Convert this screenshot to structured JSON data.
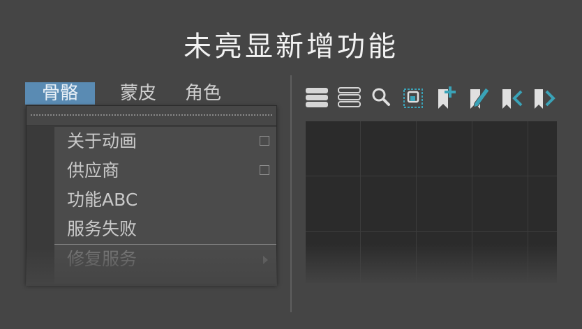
{
  "title": "未亮显新增功能",
  "tabs": [
    {
      "label": "骨骼",
      "active": true
    },
    {
      "label": "蒙皮",
      "active": false
    },
    {
      "label": "角色",
      "active": false
    }
  ],
  "menu": {
    "items": [
      {
        "label": "关于动画",
        "checkbox": true,
        "checked": false
      },
      {
        "label": "供应商",
        "checkbox": true,
        "checked": false
      },
      {
        "label": "功能ABC"
      },
      {
        "label": "服务失败"
      },
      {
        "label": "修复服务",
        "submenu": true,
        "disabled": true
      }
    ]
  },
  "toolbar": {
    "icons": [
      "filled-list-icon",
      "outline-list-icon",
      "search-icon",
      "frame-selection-icon",
      "add-bookmark-icon",
      "edit-bookmark-icon",
      "previous-bookmark-icon",
      "next-bookmark-icon"
    ]
  },
  "colors": {
    "background": "#454545",
    "active_tab": "#5a8bb3",
    "accent": "#3aa3b8"
  }
}
